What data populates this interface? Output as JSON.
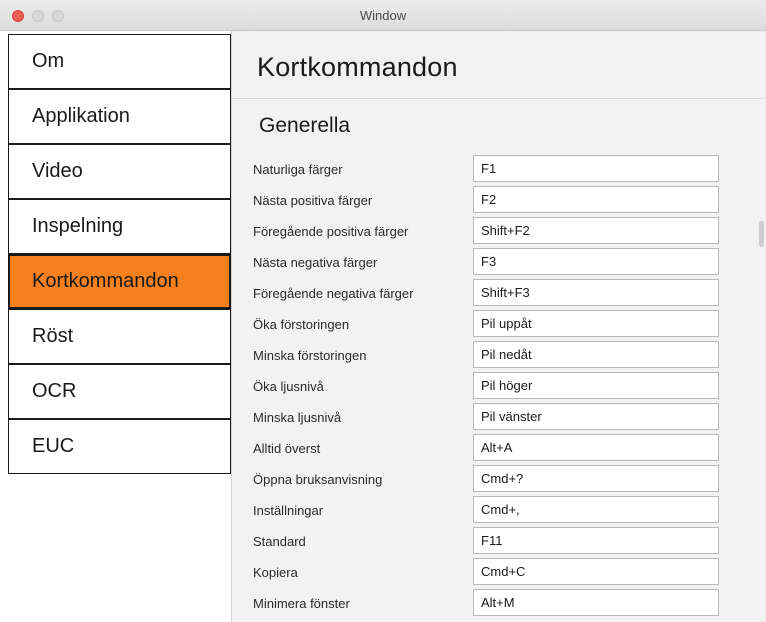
{
  "window": {
    "title": "Window"
  },
  "sidebar": {
    "items": [
      {
        "label": "Om"
      },
      {
        "label": "Applikation"
      },
      {
        "label": "Video"
      },
      {
        "label": "Inspelning"
      },
      {
        "label": "Kortkommandon",
        "active": true
      },
      {
        "label": "Röst"
      },
      {
        "label": "OCR"
      },
      {
        "label": "EUC"
      }
    ]
  },
  "page": {
    "title": "Kortkommandon",
    "section_title": "Generella",
    "shortcuts": [
      {
        "label": "Naturliga färger",
        "value": "F1"
      },
      {
        "label": "Nästa positiva färger",
        "value": "F2"
      },
      {
        "label": "Föregående positiva färger",
        "value": "Shift+F2"
      },
      {
        "label": "Nästa negativa färger",
        "value": "F3"
      },
      {
        "label": "Föregående negativa färger",
        "value": "Shift+F3"
      },
      {
        "label": "Öka förstoringen",
        "value": "Pil uppåt"
      },
      {
        "label": "Minska förstoringen",
        "value": "Pil nedåt"
      },
      {
        "label": "Öka ljusnivå",
        "value": "Pil höger"
      },
      {
        "label": "Minska ljusnivå",
        "value": "Pil vänster"
      },
      {
        "label": "Alltid överst",
        "value": "Alt+A"
      },
      {
        "label": "Öppna bruksanvisning",
        "value": "Cmd+?"
      },
      {
        "label": "Inställningar",
        "value": "Cmd+,"
      },
      {
        "label": "Standard",
        "value": "F11"
      },
      {
        "label": "Kopiera",
        "value": "Cmd+C"
      },
      {
        "label": "Minimera fönster",
        "value": "Alt+M"
      }
    ]
  },
  "colors": {
    "accent": "#f7801e",
    "close_button": "#ee5d55"
  }
}
